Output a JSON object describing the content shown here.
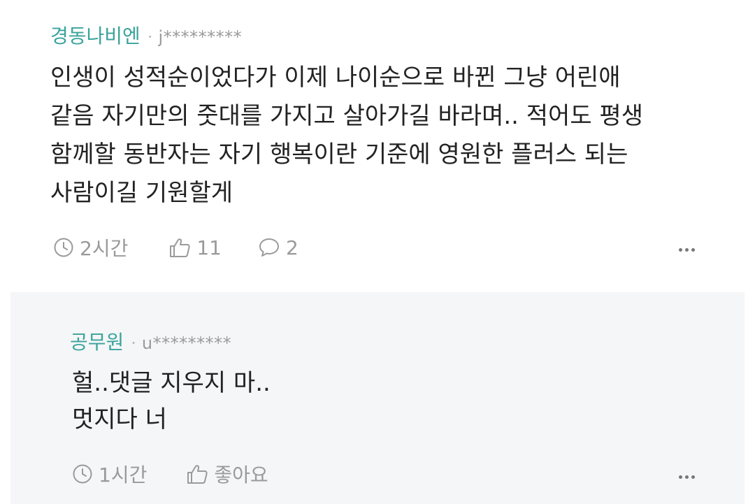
{
  "comment": {
    "nickname": "경동나비엔",
    "separator": "·",
    "user_id": "j*********",
    "lines": [
      "인생이 성적순이었다가 이제 나이순으로 바뀐 그냥 어린애",
      "같음 자기만의 줏대를 가지고 살아가길 바라며.. 적어도 평생",
      "함께할 동반자는 자기 행복이란 기준에 영원한 플러스 되는",
      "사람이길 기원할게"
    ],
    "time": "2시간",
    "likes": "11",
    "replies": "2",
    "icons": {
      "time": "clock-icon",
      "like": "thumbs-up-icon",
      "reply": "speech-bubble-icon",
      "more": "more-dots-icon"
    }
  },
  "reply": {
    "nickname": "공무원",
    "separator": "·",
    "user_id": "u*********",
    "lines": [
      "헐..댓글 지우지 마..",
      "멋지다 너"
    ],
    "time": "1시간",
    "like_label": "좋아요",
    "icons": {
      "time": "clock-icon",
      "like": "thumbs-up-icon",
      "more": "more-dots-icon"
    }
  },
  "colors": {
    "nickname": "#3aa39b",
    "meta": "#9a9a9a",
    "reply_background": "#f5f6f7",
    "body_text": "#222222"
  }
}
